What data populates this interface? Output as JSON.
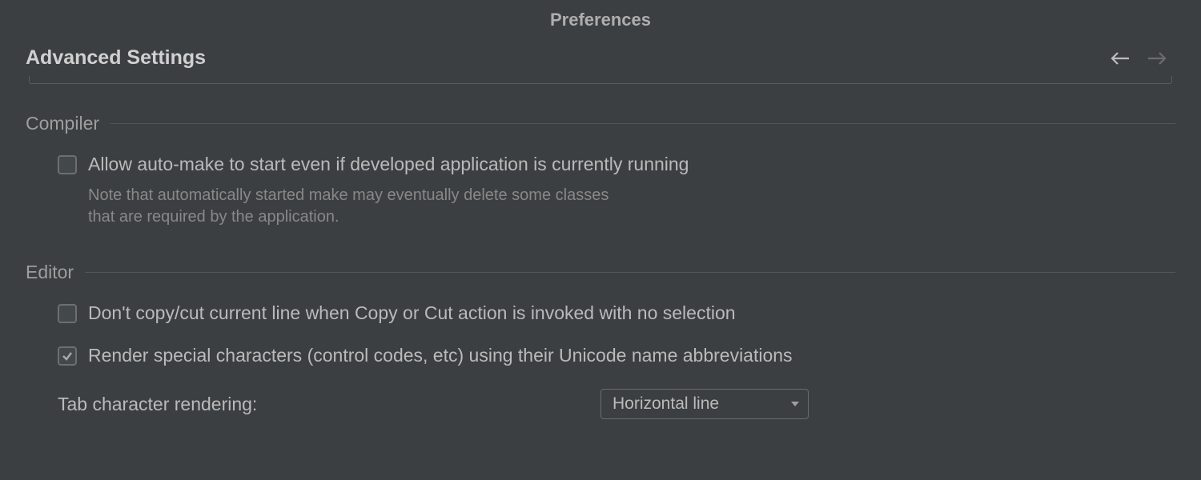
{
  "window": {
    "title": "Preferences"
  },
  "page": {
    "title": "Advanced Settings"
  },
  "sections": {
    "compiler": {
      "title": "Compiler",
      "allow_auto_make": {
        "label": "Allow auto-make to start even if developed application is currently running",
        "note": "Note that automatically started make may eventually delete some classes that are required by the application.",
        "checked": false
      }
    },
    "editor": {
      "title": "Editor",
      "dont_copy_cut": {
        "label": "Don't copy/cut current line when Copy or Cut action is invoked with no selection",
        "checked": false
      },
      "render_special": {
        "label": "Render special characters (control codes, etc) using their Unicode name abbreviations",
        "checked": true
      },
      "tab_rendering": {
        "label": "Tab character rendering:",
        "value": "Horizontal line"
      }
    }
  }
}
